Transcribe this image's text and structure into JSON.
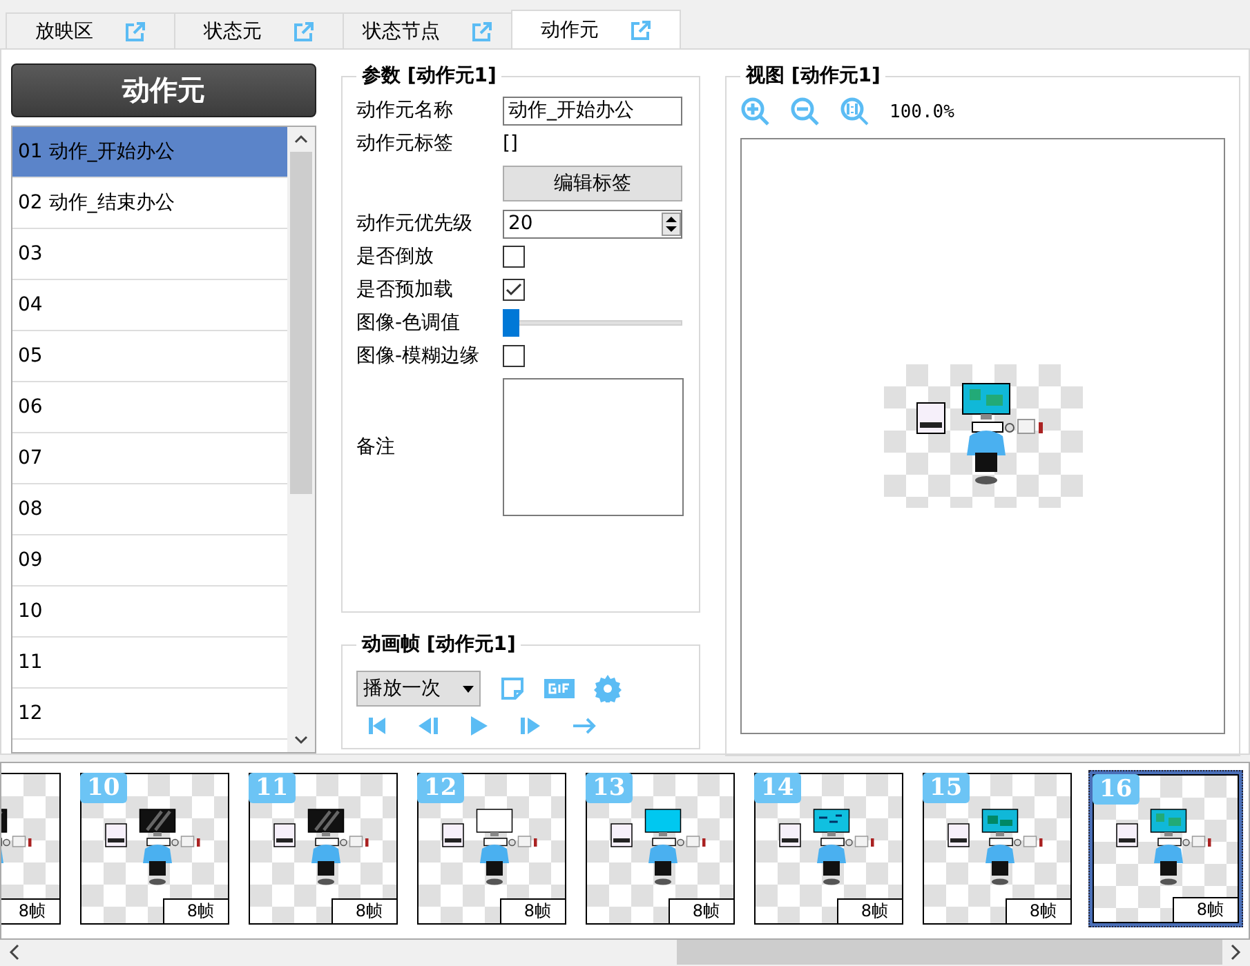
{
  "tabs": [
    {
      "label": "放映区",
      "selected": false
    },
    {
      "label": "状态元",
      "selected": false
    },
    {
      "label": "状态节点",
      "selected": false
    },
    {
      "label": "动作元",
      "selected": true
    }
  ],
  "sidebar": {
    "title": "动作元",
    "items": [
      {
        "label": "01 动作_开始办公",
        "selected": true
      },
      {
        "label": "02 动作_结束办公",
        "selected": false
      },
      {
        "label": "03",
        "selected": false
      },
      {
        "label": "04",
        "selected": false
      },
      {
        "label": "05",
        "selected": false
      },
      {
        "label": "06",
        "selected": false
      },
      {
        "label": "07",
        "selected": false
      },
      {
        "label": "08",
        "selected": false
      },
      {
        "label": "09",
        "selected": false
      },
      {
        "label": "10",
        "selected": false
      },
      {
        "label": "11",
        "selected": false
      },
      {
        "label": "12",
        "selected": false
      }
    ]
  },
  "params": {
    "title": "参数 [动作元1]",
    "fields": [
      {
        "kind": "text",
        "label": "动作元名称",
        "value": "动作_开始办公"
      },
      {
        "kind": "static",
        "label": "动作元标签",
        "value": "[]"
      },
      {
        "kind": "button",
        "label": "编辑标签"
      },
      {
        "kind": "spin",
        "label": "动作元优先级",
        "value": "20"
      },
      {
        "kind": "check",
        "label": "是否倒放",
        "checked": false
      },
      {
        "kind": "check",
        "label": "是否预加载",
        "checked": true
      },
      {
        "kind": "slider",
        "label": "图像-色调值",
        "level": 0
      },
      {
        "kind": "check",
        "label": "图像-模糊边缘",
        "checked": false
      },
      {
        "kind": "memo",
        "label": "备注"
      }
    ]
  },
  "animation": {
    "title": "动画帧 [动作元1]",
    "mode": "播放一次"
  },
  "view": {
    "title": "视图 [动作元1]",
    "zoom": "100.0%"
  },
  "frames": [
    {
      "kind": "glare",
      "count": "8帧",
      "selected": false
    },
    {
      "number": "10",
      "kind": "glare",
      "count": "8帧",
      "selected": false
    },
    {
      "number": "11",
      "kind": "glare",
      "count": "8帧",
      "selected": false
    },
    {
      "number": "12",
      "kind": "white",
      "count": "8帧",
      "selected": false
    },
    {
      "number": "13",
      "kind": "blue",
      "count": "8帧",
      "selected": false
    },
    {
      "number": "14",
      "kind": "lines",
      "count": "8帧",
      "selected": false
    },
    {
      "number": "15",
      "kind": "windows",
      "count": "8帧",
      "selected": false
    },
    {
      "number": "16",
      "kind": "icons",
      "count": "8帧",
      "selected": true
    }
  ]
}
